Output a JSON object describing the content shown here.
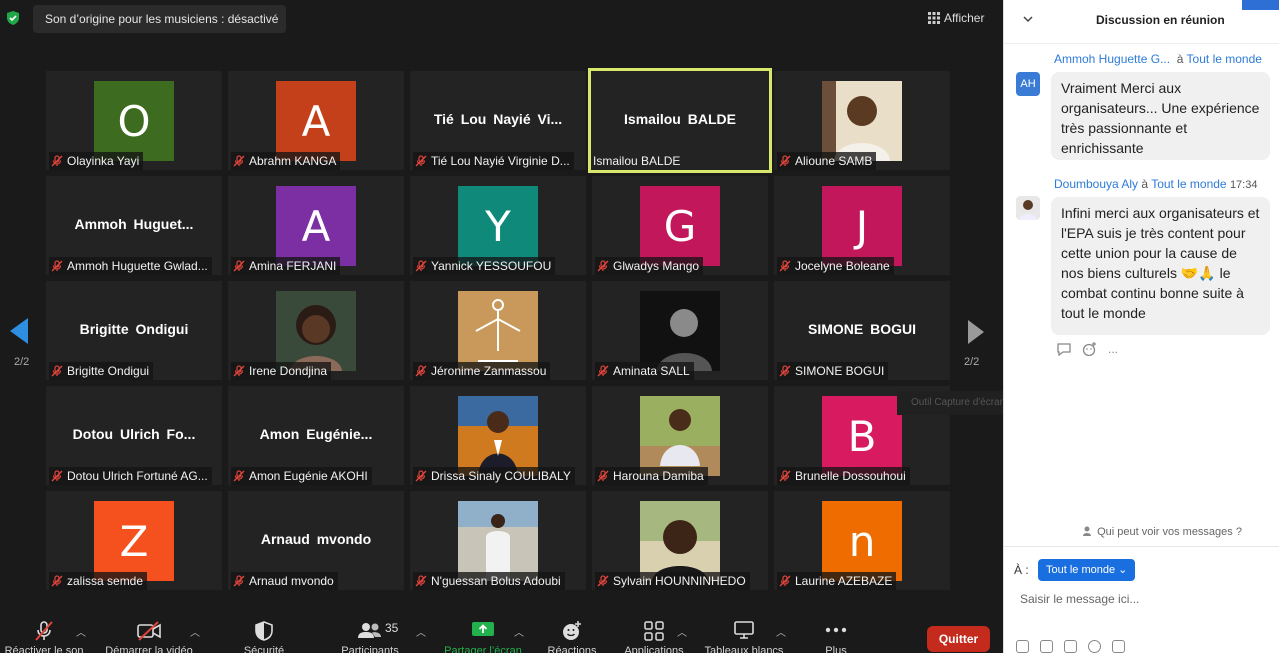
{
  "top": {
    "notice": "Son d’origine pour les musiciens : désactivé",
    "view_label": "Afficher"
  },
  "tiles": [
    {
      "name": "Olayinka Yayi",
      "letter": "O",
      "color": "#3d6b1f"
    },
    {
      "name": "Abrahm KANGA",
      "letter": "A",
      "color": "#c4401a"
    },
    {
      "name": "Tié Lou Nayié Virginie D...",
      "bigname": "Tié Lou Nayié Vi..."
    },
    {
      "name": "Ismailou BALDE",
      "bigname": "Ismailou BALDE",
      "active": true
    },
    {
      "name": "Alioune SAMB",
      "photo": "man-light-bg"
    },
    {
      "name": "Ammoh Huguette Gwlad...",
      "bigname": "Ammoh Huguet..."
    },
    {
      "name": "Amina FERJANI",
      "letter": "A",
      "color": "#7b2fa3"
    },
    {
      "name": "Yannick YESSOUFOU",
      "letter": "Y",
      "color": "#0f8a7a"
    },
    {
      "name": "Glwadys Mango",
      "letter": "G",
      "color": "#c2185b"
    },
    {
      "name": "Jocelyne Boleane",
      "letter": "J",
      "color": "#c2185b"
    },
    {
      "name": "Brigitte Ondigui",
      "bigname": "Brigitte Ondigui"
    },
    {
      "name": "Irene Dondjina",
      "photo": "woman-portrait"
    },
    {
      "name": "Jéronime Zanmassou",
      "photo": "epa-logo"
    },
    {
      "name": "Aminata SALL",
      "photo": "bw-portrait"
    },
    {
      "name": "SIMONE BOGUI",
      "bigname": "SIMONE BOGUI"
    },
    {
      "name": "Dotou Ulrich Fortuné AG...",
      "bigname": "Dotou Ulrich Fo..."
    },
    {
      "name": "Amon Eugénie AKOHI",
      "bigname": "Amon Eugénie..."
    },
    {
      "name": "Drissa Sinaly COULIBALY",
      "photo": "man-suit-art"
    },
    {
      "name": "Harouna Damiba",
      "photo": "man-outdoor"
    },
    {
      "name": "Brunelle Dossouhoui",
      "letter": "B",
      "color": "#d81b60"
    },
    {
      "name": "zalissa semde",
      "letter": "Z",
      "color": "#f4511e"
    },
    {
      "name": "Arnaud mvondo",
      "bigname": "Arnaud mvondo"
    },
    {
      "name": "N'guessan Bolus Adoubi",
      "photo": "man-standing"
    },
    {
      "name": "Sylvain HOUNNINHEDO",
      "photo": "man-selfie"
    },
    {
      "name": "Laurine AZEBAZE",
      "letter": "n",
      "color": "#ef6c00"
    }
  ],
  "paging": {
    "left": "2/2",
    "right": "2/2"
  },
  "tooltip": "Outil Capture d'écran",
  "toolbar": {
    "mute": "Réactiver le son",
    "video": "Démarrer la vidéo",
    "security": "Sécurité",
    "participants": "Participants",
    "participants_count": "35",
    "share": "Partager l’écran",
    "reactions": "Réactions",
    "apps": "Applications",
    "whiteboards": "Tableaux blancs",
    "more": "Plus",
    "quit": "Quitter"
  },
  "chat": {
    "title": "Discussion en réunion",
    "messages": [
      {
        "sender": "Ammoh Huguette G...",
        "to_prefix": "à",
        "to": "Tout le monde",
        "time": "",
        "initials": "AH",
        "text": "Vraiment Merci aux organisateurs... Une expérience très passionnante et enrichissante"
      },
      {
        "sender": "Doumbouya Aly",
        "to_prefix": "à",
        "to": "Tout le monde",
        "time": "17:34",
        "initials": "",
        "text": "Infini merci aux organisateurs et l'EPA suis je très content pour cette union pour la cause de nos biens culturels 🤝🙏 le combat continu bonne suite à  tout le monde"
      }
    ],
    "more_icon": "...",
    "who_can_see": "Qui peut voir vos messages ?",
    "to_label": "À :",
    "to_select": "Tout le monde",
    "input_placeholder": "Saisir le message ici..."
  }
}
